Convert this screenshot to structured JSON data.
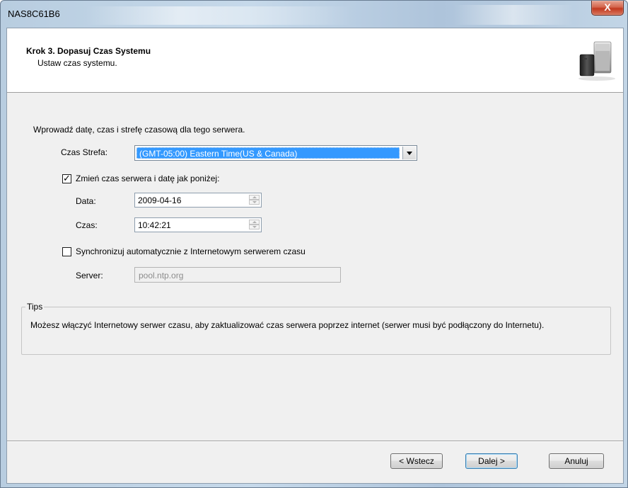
{
  "window": {
    "title": "NAS8C61B6",
    "close_glyph": "X"
  },
  "header": {
    "title": "Krok 3. Dopasuj Czas Systemu",
    "subtitle": "Ustaw czas systemu.",
    "icon": "nas-server-icon"
  },
  "form": {
    "intro": "Wprowadź datę, czas i strefę czasową dla tego serwera.",
    "timezone_label": "Czas Strefa:",
    "timezone_value": "(GMT-05:00) Eastern Time(US & Canada)",
    "change_checkbox_label": "Zmień czas serwera i datę jak poniżej:",
    "change_checked": true,
    "date_label": "Data:",
    "date_value": "2009-04-16",
    "time_label": "Czas:",
    "time_value": "10:42:21",
    "sync_checkbox_label": "Synchronizuj automatycznie z Internetowym serwerem czasu",
    "sync_checked": false,
    "server_label": "Server:",
    "server_value": "pool.ntp.org"
  },
  "tips": {
    "legend": "Tips",
    "text": "Możesz włączyć Internetowy serwer czasu, aby zaktualizować czas serwera poprzez internet (serwer musi być podłączony do Internetu)."
  },
  "buttons": {
    "back": "< Wstecz",
    "next": "Dalej >",
    "cancel": "Anuluj"
  },
  "colors": {
    "selection": "#3399ff",
    "close_button": "#c2391f"
  }
}
